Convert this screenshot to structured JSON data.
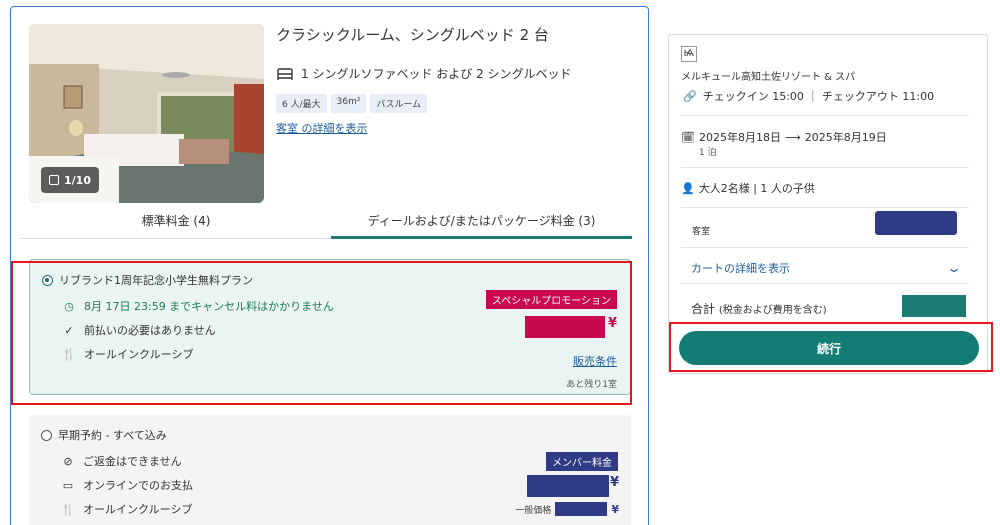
{
  "room": {
    "title": "クラシックルーム、シングルベッド 2 台",
    "beds": "1 シングルソファベッド および 2 シングルベッド",
    "tags": [
      "6 人/最大",
      "36m²",
      "バスルーム"
    ],
    "detail_link": "客室 の詳細を表示",
    "photo_counter": "1/10"
  },
  "tabs": [
    {
      "label": "標準料金 (4)",
      "active": false
    },
    {
      "label": "ディールおよび/またはパッケージ料金 (3)",
      "active": true
    }
  ],
  "plans": [
    {
      "name": "リブランド1周年記念小学生無料プラン",
      "selected": true,
      "features": [
        {
          "icon": "clock-check-icon",
          "text": "8月 17日 23:59 までキャンセル料はかかりません"
        },
        {
          "icon": "checkmark-icon",
          "text": "前払いの必要はありません"
        },
        {
          "icon": "fork-knife-icon",
          "text": "オールインクルーシブ"
        }
      ],
      "badge": "スペシャルプロモーション",
      "currency": "¥",
      "terms_link": "販売条件",
      "remaining": "あと残り1室"
    },
    {
      "name": "早期予約 - すべて込み",
      "selected": false,
      "features": [
        {
          "icon": "no-refund-icon",
          "text": "ご返金はできません"
        },
        {
          "icon": "card-icon",
          "text": "オンラインでのお支払"
        },
        {
          "icon": "fork-knife-icon",
          "text": "オールインクルーシブ"
        }
      ],
      "badge": "メンバー料金",
      "currency": "¥",
      "regular_label": "一般価格",
      "regular_currency": "¥"
    }
  ],
  "summary": {
    "logo_text": "Ѩ",
    "hotel_name": "メルキュール高知土佐リゾート & スパ",
    "checkinout": "チェックイン 15:00 ｜ チェックアウト 11:00",
    "date_from": "2025年8月18日",
    "arrow": "⟶",
    "date_to": "2025年8月19日",
    "nights": "1 泊",
    "guests": "大人2名様 | 1 人の子供",
    "room_label": "客室",
    "cart_link": "カートの詳細を表示",
    "total_label": "合計",
    "total_note": "(税金および費用を含む)",
    "continue_label": "続行"
  },
  "colors": {
    "accent_teal": "#137c74",
    "promo_red": "#c9084f",
    "member_blue": "#2f3c85",
    "highlight_red": "#e3191c"
  }
}
